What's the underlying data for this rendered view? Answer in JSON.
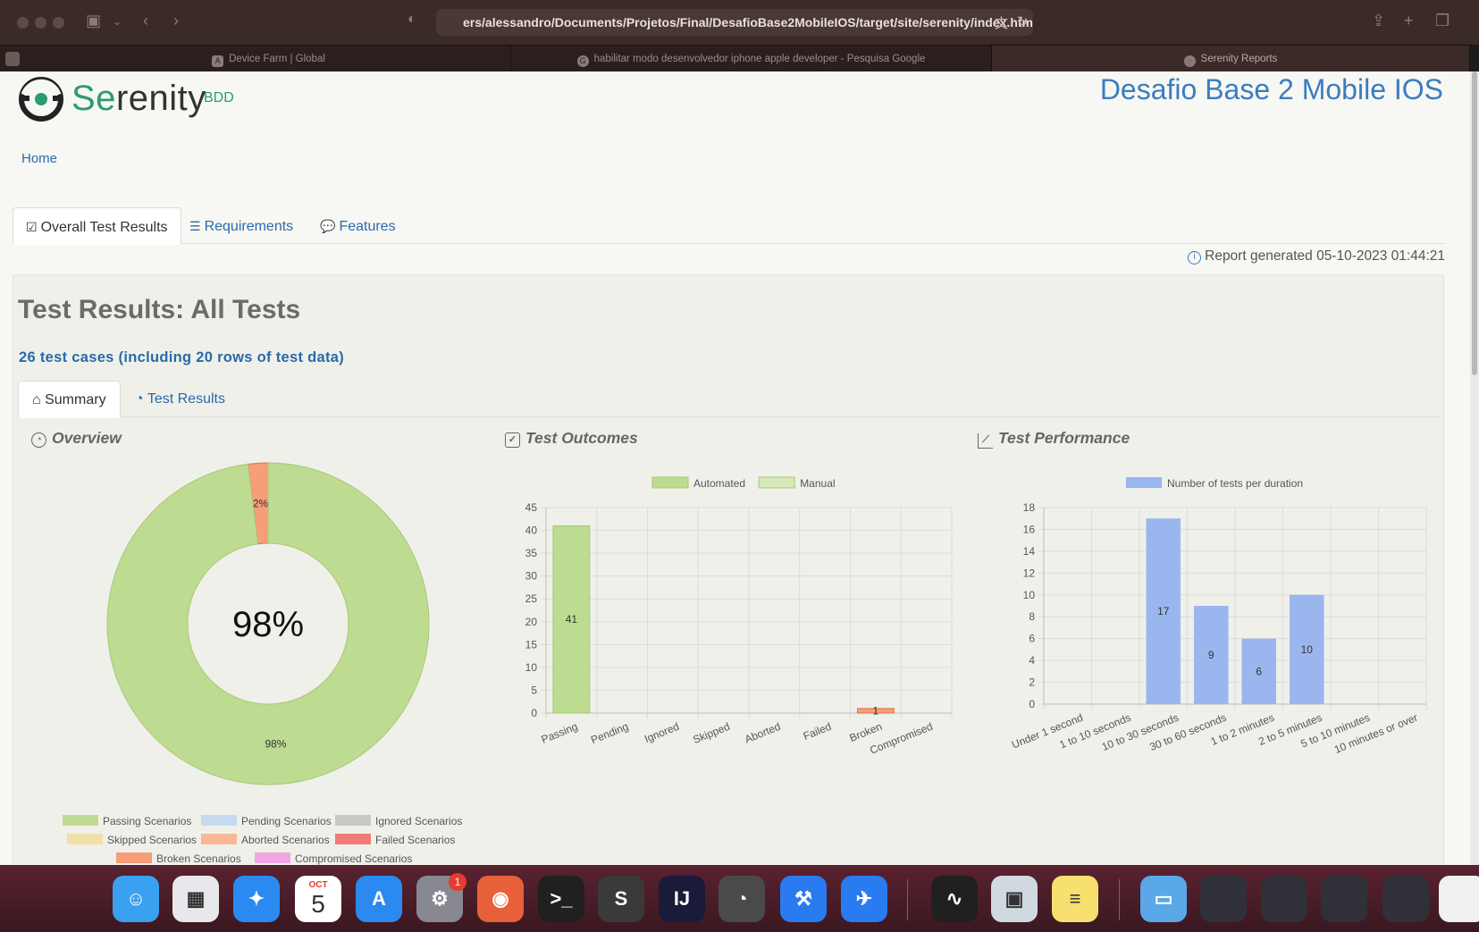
{
  "browser": {
    "url": "ers/alessandro/Documents/Projetos/Final/DesafioBase2MobileIOS/target/site/serenity/index.html",
    "tabs": [
      {
        "label": "Device Farm | Global",
        "icon": "device-farm-favicon"
      },
      {
        "label": "habilitar modo desenvolvedor iphone apple developer - Pesquisa Google",
        "icon": "google-favicon"
      },
      {
        "label": "Serenity Reports",
        "icon": "serenity-favicon",
        "active": true
      }
    ]
  },
  "header": {
    "logo_text_prefix": "Se",
    "logo_text_suffix": "renity",
    "logo_badge": "BDD",
    "project_title": "Desafio Base 2 Mobile IOS"
  },
  "breadcrumb": {
    "home": "Home"
  },
  "main_tabs": [
    {
      "label": "Overall Test Results",
      "icon": "checklist-icon",
      "active": true
    },
    {
      "label": "Requirements",
      "icon": "list-icon"
    },
    {
      "label": "Features",
      "icon": "comment-icon"
    }
  ],
  "report_generated": "Report generated 05-10-2023 01:44:21",
  "results": {
    "heading": "Test Results: All Tests",
    "case_count": "26 test cases (including 20 rows of test data)"
  },
  "sub_tabs": [
    {
      "label": "Summary",
      "icon": "home-icon",
      "active": true
    },
    {
      "label": "Test Results",
      "icon": "gauge-icon"
    }
  ],
  "sections": {
    "overview": "Overview",
    "outcomes": "Test Outcomes",
    "performance": "Test Performance"
  },
  "colors": {
    "passing": "#bedc91",
    "pending": "#c6dbef",
    "ignored": "#c8c8c4",
    "skipped": "#efe0a8",
    "aborted": "#f8b897",
    "failed": "#f07a78",
    "broken": "#f59e78",
    "compromised": "#f0a6e4",
    "performance": "#9ab6ee"
  },
  "chart_data": [
    {
      "type": "pie",
      "title": "Overview",
      "center_label": "98%",
      "slices": [
        {
          "label": "Passing Scenarios",
          "value": 98,
          "data_label": "98%",
          "color": "#bedc91"
        },
        {
          "label": "Broken Scenarios",
          "value": 2,
          "data_label": "2%",
          "color": "#f59e78"
        }
      ],
      "legend": [
        {
          "label": "Passing Scenarios",
          "color": "#bedc91"
        },
        {
          "label": "Pending Scenarios",
          "color": "#c6dbef"
        },
        {
          "label": "Ignored Scenarios",
          "color": "#c8c8c4"
        },
        {
          "label": "Skipped Scenarios",
          "color": "#efe0a8"
        },
        {
          "label": "Aborted Scenarios",
          "color": "#f8b897"
        },
        {
          "label": "Failed Scenarios",
          "color": "#f07a78"
        },
        {
          "label": "Broken Scenarios",
          "color": "#f59e78"
        },
        {
          "label": "Compromised Scenarios",
          "color": "#f0a6e4"
        }
      ],
      "legend_position": "bottom"
    },
    {
      "type": "bar",
      "title": "Test Outcomes",
      "categories": [
        "Passing",
        "Pending",
        "Ignored",
        "Skipped",
        "Aborted",
        "Failed",
        "Broken",
        "Compromised"
      ],
      "series": [
        {
          "name": "Automated",
          "values": [
            41,
            0,
            0,
            0,
            0,
            0,
            1,
            0
          ]
        },
        {
          "name": "Manual",
          "values": [
            0,
            0,
            0,
            0,
            0,
            0,
            0,
            0
          ]
        }
      ],
      "bar_colors": [
        "#bedc91",
        "#c6dbef",
        "#c8c8c4",
        "#efe0a8",
        "#f8b897",
        "#f07a78",
        "#f59e78",
        "#f0a6e4"
      ],
      "ylim": [
        0,
        45
      ],
      "yticks": [
        0,
        5,
        10,
        15,
        20,
        25,
        30,
        35,
        40,
        45
      ],
      "grid": true,
      "legend_position": "top"
    },
    {
      "type": "bar",
      "title": "Test Performance",
      "categories": [
        "Under 1 second",
        "1 to 10 seconds",
        "10 to 30 seconds",
        "30 to 60 seconds",
        "1 to 2 minutes",
        "2 to 5 minutes",
        "5 to 10 minutes",
        "10 minutes or over"
      ],
      "series": [
        {
          "name": "Number of tests per duration",
          "values": [
            0,
            0,
            17,
            9,
            6,
            10,
            0,
            0
          ]
        }
      ],
      "ylim": [
        0,
        18
      ],
      "yticks": [
        0,
        2,
        4,
        6,
        8,
        10,
        12,
        14,
        16,
        18
      ],
      "grid": true,
      "legend_position": "top"
    }
  ],
  "dock": [
    {
      "name": "finder-icon",
      "color": "#3aa0f0",
      "glyph": "☺"
    },
    {
      "name": "launchpad-icon",
      "color": "#e8e8ec",
      "glyph": "▦"
    },
    {
      "name": "safari-icon",
      "color": "#2a8af0",
      "glyph": "✦"
    },
    {
      "name": "calendar-icon",
      "color": "#ffffff",
      "glyph": "5"
    },
    {
      "name": "app-store-icon",
      "color": "#2a8af0",
      "glyph": "A"
    },
    {
      "name": "system-settings-icon",
      "color": "#888890",
      "glyph": "⚙"
    },
    {
      "name": "firefox-icon",
      "color": "#e8603a",
      "glyph": "◉"
    },
    {
      "name": "terminal-icon",
      "color": "#202020",
      "glyph": ">_"
    },
    {
      "name": "sublime-text-icon",
      "color": "#3a3a3a",
      "glyph": "S"
    },
    {
      "name": "intellij-icon",
      "color": "#1a1a3a",
      "glyph": "IJ"
    },
    {
      "name": "instruments-icon",
      "color": "#4a4a4a",
      "glyph": "◔"
    },
    {
      "name": "xcode-icon",
      "color": "#2a7af0",
      "glyph": "⚒"
    },
    {
      "name": "simulator-icon",
      "color": "#2a7af0",
      "glyph": "✈"
    },
    {
      "name": "activity-monitor-icon",
      "color": "#202020",
      "glyph": "∿"
    },
    {
      "name": "preview-icon",
      "color": "#d0d8e0",
      "glyph": "▣"
    },
    {
      "name": "notes-icon",
      "color": "#f8e070",
      "glyph": "≡"
    },
    {
      "name": "downloads-folder-icon",
      "color": "#5aa8e8",
      "glyph": "▭"
    },
    {
      "name": "minimized-window-1",
      "color": "#303038",
      "glyph": ""
    },
    {
      "name": "minimized-window-2",
      "color": "#303038",
      "glyph": ""
    },
    {
      "name": "minimized-window-3",
      "color": "#303038",
      "glyph": ""
    },
    {
      "name": "minimized-window-4",
      "color": "#303038",
      "glyph": ""
    },
    {
      "name": "minimized-window-5",
      "color": "#f0f0f0",
      "glyph": ""
    }
  ],
  "dock_calendar_month": "OCT",
  "dock_badge": "1"
}
